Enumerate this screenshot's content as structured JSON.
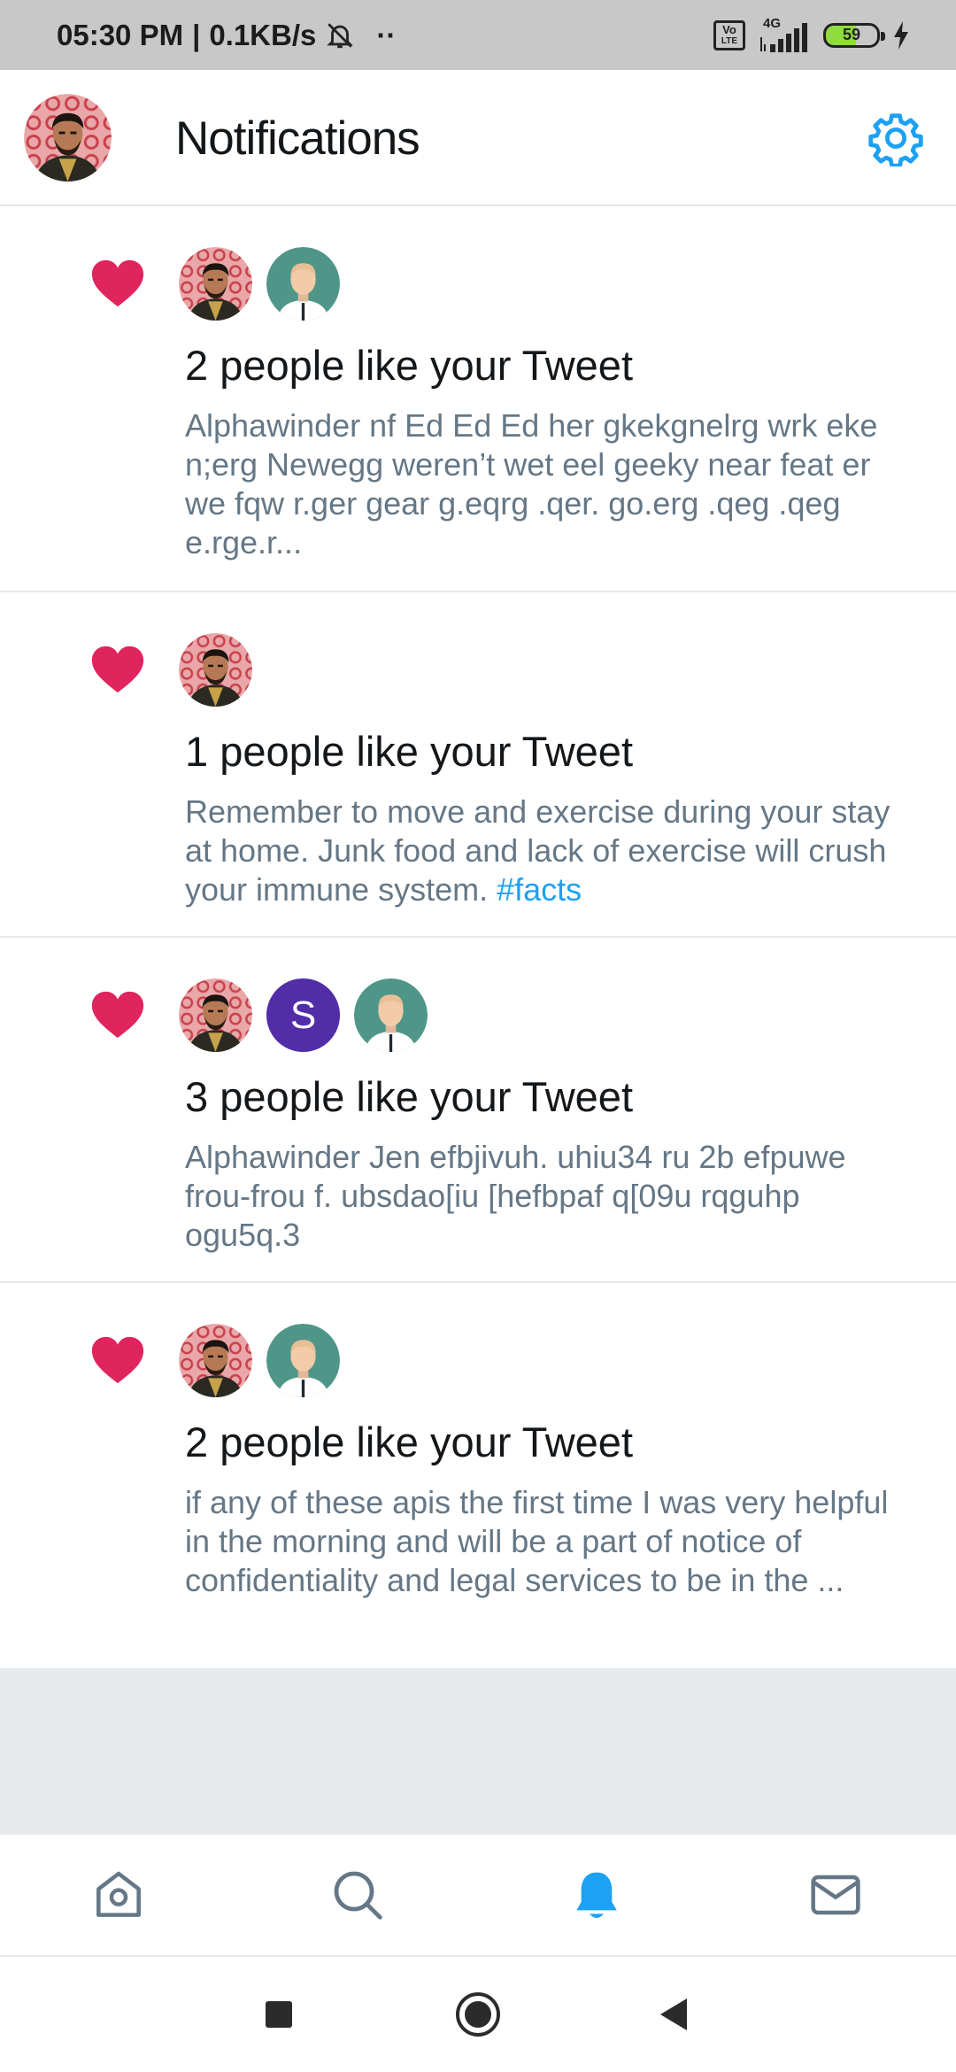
{
  "status_bar": {
    "time": "05:30 PM",
    "speed": "0.1KB/s",
    "dots": "··",
    "volte_top": "Vo",
    "volte_bottom": "LTE",
    "network": "4G",
    "battery": "59"
  },
  "header": {
    "title": "Notifications",
    "icons": {
      "avatar": "user-avatar",
      "settings": "gear-icon"
    },
    "accent": "#1da1f2"
  },
  "notifications": [
    {
      "headline": "2 people like your Tweet",
      "body": "Alphawinder nf Ed Ed Ed her gkekgnelrg wrk eke n;erg Newegg weren’t wet eel geeky near feat er we fqw r.ger gear g.eqrg .qer. go.erg .qeg .qeg e.rge.r...",
      "avatars": [
        "user-photo",
        "generic-man"
      ]
    },
    {
      "headline": "1 people like your Tweet",
      "body": "Remember to move and exercise  during your stay at home. Junk food and lack of exercise will crush your immune system. ",
      "hashtag": "#facts",
      "avatars": [
        "user-photo"
      ]
    },
    {
      "headline": "3 people like your Tweet",
      "body": "Alphawinder Jen efbjivuh.  uhiu34 ru 2b efpuwe frou-frou f.  ubsdao[iu [hefbpaf q[09u rqguhp ogu5q.3",
      "avatars": [
        "user-photo",
        "letter-s",
        "generic-man"
      ],
      "letter_avatar": "S"
    },
    {
      "headline": "2 people like your Tweet",
      "body": "if any of these apis the first time I was very helpful in the morning and will be a part of notice of confidentiality and legal services to be in the ...",
      "avatars": [
        "user-photo",
        "generic-man"
      ]
    }
  ],
  "colors": {
    "heart": "#e0245e",
    "headline": "#14171a",
    "body": "#657786",
    "hashtag": "#1da1f2",
    "letter_avatar": "#512da8"
  },
  "tabbar": {
    "tabs": [
      "home-icon",
      "search-icon",
      "bell-icon",
      "mail-icon"
    ],
    "active": "bell-icon"
  },
  "system_nav": [
    "recents-button",
    "home-button",
    "back-button"
  ]
}
